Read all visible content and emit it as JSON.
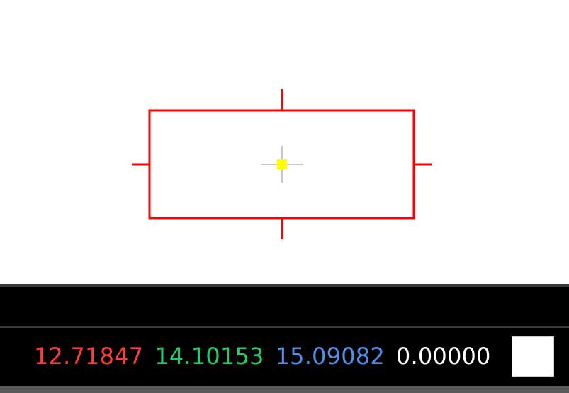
{
  "status": {
    "x": "12.71847",
    "y": "14.10153",
    "z": "15.09082",
    "w": "0.00000"
  },
  "colors": {
    "x": "#ff3a3a",
    "y": "#22cc66",
    "z": "#4f8fe6",
    "w": "#ffffff",
    "selection": "#ff0000",
    "anchor": "#ffff00",
    "crosshair": "#c8c8c8"
  },
  "icons": {
    "selection-handle": "line",
    "center-anchor": "square",
    "crosshair": "plus"
  }
}
